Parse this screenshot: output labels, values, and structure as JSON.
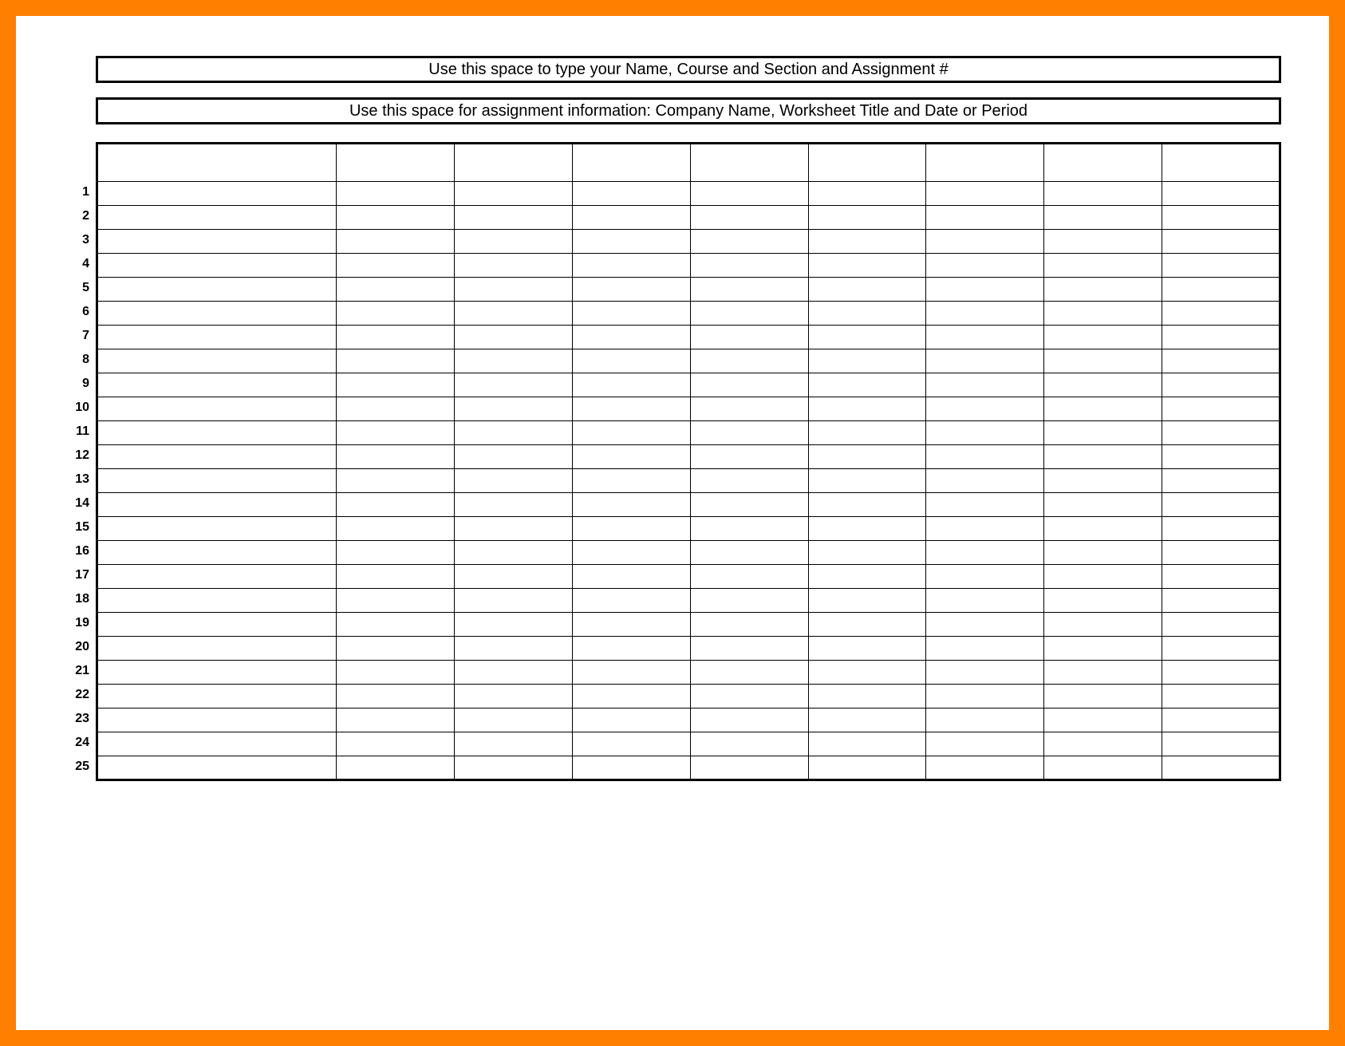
{
  "headers": {
    "line1": "Use this space to type your Name, Course and Section and Assignment #",
    "line2": "Use this space for assignment information: Company Name, Worksheet Title and Date or Period"
  },
  "grid": {
    "column_count": 9,
    "row_count": 25,
    "row_numbers": [
      "1",
      "2",
      "3",
      "4",
      "5",
      "6",
      "7",
      "8",
      "9",
      "10",
      "11",
      "12",
      "13",
      "14",
      "15",
      "16",
      "17",
      "18",
      "19",
      "20",
      "21",
      "22",
      "23",
      "24",
      "25"
    ],
    "column_headers": [
      "",
      "",
      "",
      "",
      "",
      "",
      "",
      "",
      ""
    ],
    "cells": [
      [
        "",
        "",
        "",
        "",
        "",
        "",
        "",
        "",
        ""
      ],
      [
        "",
        "",
        "",
        "",
        "",
        "",
        "",
        "",
        ""
      ],
      [
        "",
        "",
        "",
        "",
        "",
        "",
        "",
        "",
        ""
      ],
      [
        "",
        "",
        "",
        "",
        "",
        "",
        "",
        "",
        ""
      ],
      [
        "",
        "",
        "",
        "",
        "",
        "",
        "",
        "",
        ""
      ],
      [
        "",
        "",
        "",
        "",
        "",
        "",
        "",
        "",
        ""
      ],
      [
        "",
        "",
        "",
        "",
        "",
        "",
        "",
        "",
        ""
      ],
      [
        "",
        "",
        "",
        "",
        "",
        "",
        "",
        "",
        ""
      ],
      [
        "",
        "",
        "",
        "",
        "",
        "",
        "",
        "",
        ""
      ],
      [
        "",
        "",
        "",
        "",
        "",
        "",
        "",
        "",
        ""
      ],
      [
        "",
        "",
        "",
        "",
        "",
        "",
        "",
        "",
        ""
      ],
      [
        "",
        "",
        "",
        "",
        "",
        "",
        "",
        "",
        ""
      ],
      [
        "",
        "",
        "",
        "",
        "",
        "",
        "",
        "",
        ""
      ],
      [
        "",
        "",
        "",
        "",
        "",
        "",
        "",
        "",
        ""
      ],
      [
        "",
        "",
        "",
        "",
        "",
        "",
        "",
        "",
        ""
      ],
      [
        "",
        "",
        "",
        "",
        "",
        "",
        "",
        "",
        ""
      ],
      [
        "",
        "",
        "",
        "",
        "",
        "",
        "",
        "",
        ""
      ],
      [
        "",
        "",
        "",
        "",
        "",
        "",
        "",
        "",
        ""
      ],
      [
        "",
        "",
        "",
        "",
        "",
        "",
        "",
        "",
        ""
      ],
      [
        "",
        "",
        "",
        "",
        "",
        "",
        "",
        "",
        ""
      ],
      [
        "",
        "",
        "",
        "",
        "",
        "",
        "",
        "",
        ""
      ],
      [
        "",
        "",
        "",
        "",
        "",
        "",
        "",
        "",
        ""
      ],
      [
        "",
        "",
        "",
        "",
        "",
        "",
        "",
        "",
        ""
      ],
      [
        "",
        "",
        "",
        "",
        "",
        "",
        "",
        "",
        ""
      ],
      [
        "",
        "",
        "",
        "",
        "",
        "",
        "",
        "",
        ""
      ]
    ]
  },
  "colors": {
    "frame": "#ff7f00",
    "page": "#ffffff",
    "border": "#000000"
  }
}
